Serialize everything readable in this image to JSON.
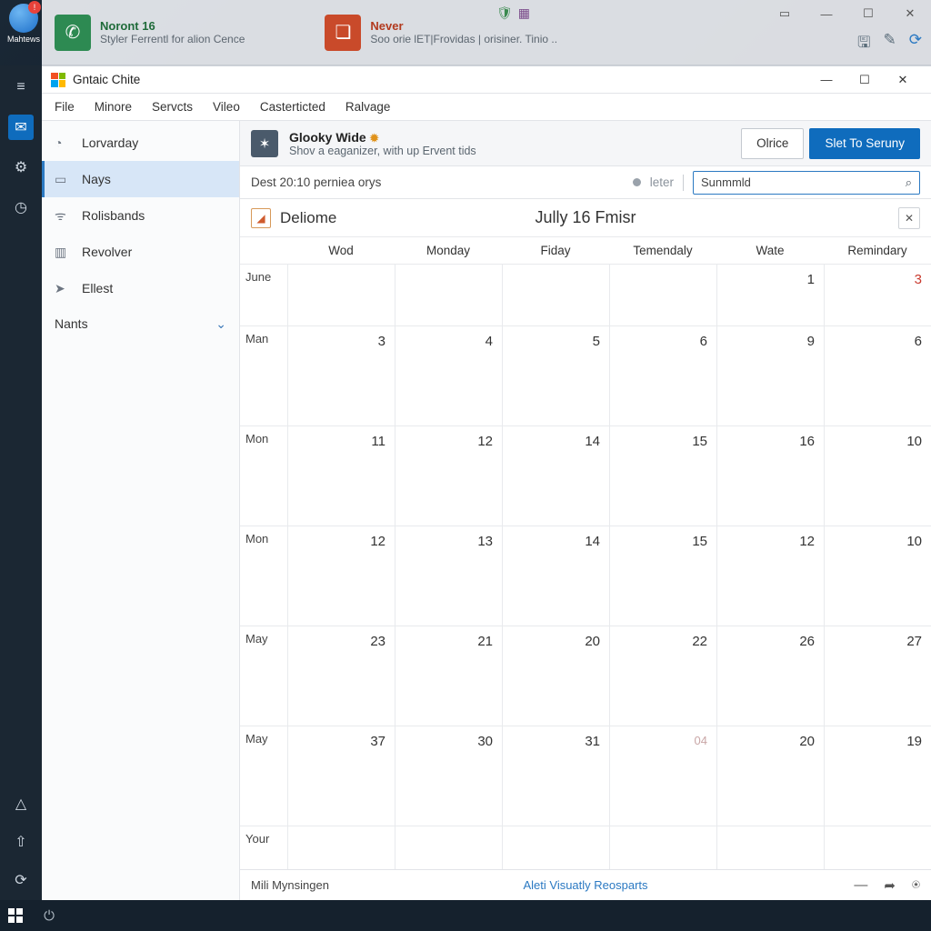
{
  "desktop_icon_label": "Mahtews",
  "notif": [
    {
      "title": "Noront 16",
      "sub": "Styler Ferrentl for alion Cence"
    },
    {
      "title": "Never",
      "sub": "Soo orie lET|Frovidas | orisiner. Tinio .."
    }
  ],
  "smallbadges": [
    "🛡",
    "▦"
  ],
  "app": {
    "title": "Gntaic Chite",
    "menu": [
      "File",
      "Minore",
      "Servcts",
      "Vileo",
      "Casterticted",
      "Ralvage"
    ]
  },
  "side": {
    "items": [
      {
        "icon": "◔",
        "label": "Lorvarday"
      },
      {
        "icon": "▭",
        "label": "Nays"
      },
      {
        "icon": "ᯤ",
        "label": "Rolisbands"
      },
      {
        "icon": "▥",
        "label": "Revolver"
      },
      {
        "icon": "➤",
        "label": "Ellest"
      }
    ],
    "group": "Nants"
  },
  "ribbon": {
    "title": "Glooky Wide",
    "sub": "Shov a eaganizer, with up Ervent tids",
    "btn_secondary": "Olrice",
    "btn_primary": "Slet To Seruny"
  },
  "subbar": {
    "left": "Dest 20:10 perniea orys",
    "toggle": "leter",
    "search": "Sunmmld"
  },
  "calhdr": {
    "label": "Deliome",
    "month": "Jully 16 Fmisr"
  },
  "days": [
    "Wod",
    "Monday",
    "Fiday",
    "Temendaly",
    "Wate",
    "Remindary"
  ],
  "rows": [
    {
      "label": "June",
      "cells": [
        "",
        "",
        "",
        "",
        "1",
        "3"
      ],
      "red": [
        5
      ]
    },
    {
      "label": "Man",
      "cells": [
        "3",
        "4",
        "5",
        "6",
        "9",
        "6"
      ]
    },
    {
      "label": "Mon",
      "cells": [
        "11",
        "12",
        "14",
        "15",
        "16",
        "10"
      ]
    },
    {
      "label": "Mon",
      "cells": [
        "12",
        "13",
        "14",
        "15",
        "12",
        "10"
      ]
    },
    {
      "label": "May",
      "cells": [
        "23",
        "21",
        "20",
        "22",
        "26",
        "27"
      ]
    },
    {
      "label": "May",
      "cells": [
        "37",
        "30",
        "31",
        "04",
        "20",
        "19"
      ],
      "pale": [
        3
      ]
    },
    {
      "label": "Your",
      "cells": [
        "",
        "",
        "",
        "",
        "",
        ""
      ]
    }
  ],
  "foot": {
    "left": "Mili Mynsingen",
    "mid": "Aleti Visuatly Reosparts"
  }
}
